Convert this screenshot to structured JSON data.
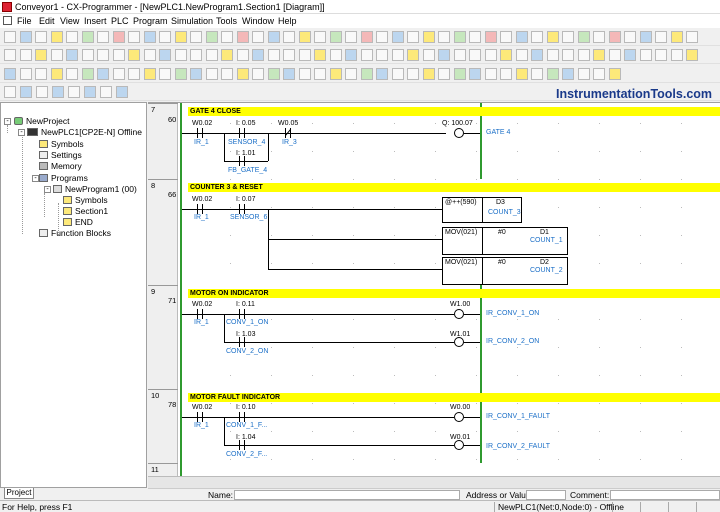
{
  "window": {
    "title": "Conveyor1 - CX-Programmer - [NewPLC1.NewProgram1.Section1 [Diagram]]"
  },
  "menu": [
    "File",
    "Edit",
    "View",
    "Insert",
    "PLC",
    "Program",
    "Simulation",
    "Tools",
    "Window",
    "Help"
  ],
  "watermark": "InstrumentationTools.com",
  "project_tree": {
    "root": "NewProject",
    "plc": "NewPLC1[CP2E-N] Offline",
    "symbols": "Symbols",
    "settings": "Settings",
    "memory": "Memory",
    "programs": "Programs",
    "program": "NewProgram1 (00)",
    "prog_symbols": "Symbols",
    "section": "Section1",
    "end": "END",
    "function_blocks": "Function Blocks",
    "tab": "Project"
  },
  "rungs": [
    {
      "number": "7",
      "step": "60",
      "title": "GATE 4 CLOSE",
      "contacts": [
        {
          "addr": "W0.02",
          "sym": "IR_1"
        },
        {
          "addr": "I: 0.05",
          "sym": "SENSOR_4"
        },
        {
          "addr": "W0.05",
          "sym": "IR_3"
        },
        {
          "addr": "I: 1.01",
          "sym": "FB_GATE_4"
        }
      ],
      "coil": {
        "addr": "Q: 100.07",
        "sym": "GATE 4"
      }
    },
    {
      "number": "8",
      "step": "66",
      "title": "COUNTER 3 & RESET",
      "contacts": [
        {
          "addr": "W0.02",
          "sym": "IR_1"
        },
        {
          "addr": "I: 0.07",
          "sym": "SENSOR_6"
        }
      ],
      "blocks": [
        {
          "instr": "@++(590)",
          "op1": "D3",
          "op1_sym": "COUNT_3",
          "op2": "",
          "op2_sym": ""
        },
        {
          "instr": "MOV(021)",
          "op1": "#0",
          "op1_sym": "",
          "op2": "D1",
          "op2_sym": "COUNT_1"
        },
        {
          "instr": "MOV(021)",
          "op1": "#0",
          "op1_sym": "",
          "op2": "D2",
          "op2_sym": "COUNT_2"
        }
      ]
    },
    {
      "number": "9",
      "step": "71",
      "title": "MOTOR ON INDICATOR",
      "contacts": [
        {
          "addr": "W0.02",
          "sym": "IR_1"
        },
        {
          "addr": "I: 0.11",
          "sym": "CONV_1_ON"
        },
        {
          "addr": "I: 1.03",
          "sym": "CONV_2_ON"
        }
      ],
      "coils": [
        {
          "addr": "W1.00",
          "sym": "IR_CONV_1_ON"
        },
        {
          "addr": "W1.01",
          "sym": "IR_CONV_2_ON"
        }
      ]
    },
    {
      "number": "10",
      "step": "78",
      "title": "MOTOR FAULT INDICATOR",
      "contacts": [
        {
          "addr": "W0.02",
          "sym": "IR_1"
        },
        {
          "addr": "I: 0.10",
          "sym": "CONV_1_F..."
        },
        {
          "addr": "I: 1.04",
          "sym": "CONV_2_F..."
        }
      ],
      "coils": [
        {
          "addr": "W0.00",
          "sym": "IR_CONV_1_FAULT"
        },
        {
          "addr": "W0.01",
          "sym": "IR_CONV_2_FAULT"
        }
      ]
    },
    {
      "number": "11"
    }
  ],
  "namebar": {
    "name_label": "Name:",
    "address_label": "Address or Value:",
    "comment_label": "Comment:"
  },
  "status": {
    "help": "For Help, press F1",
    "plc_state": "NewPLC1(Net:0,Node:0) - Offline"
  }
}
